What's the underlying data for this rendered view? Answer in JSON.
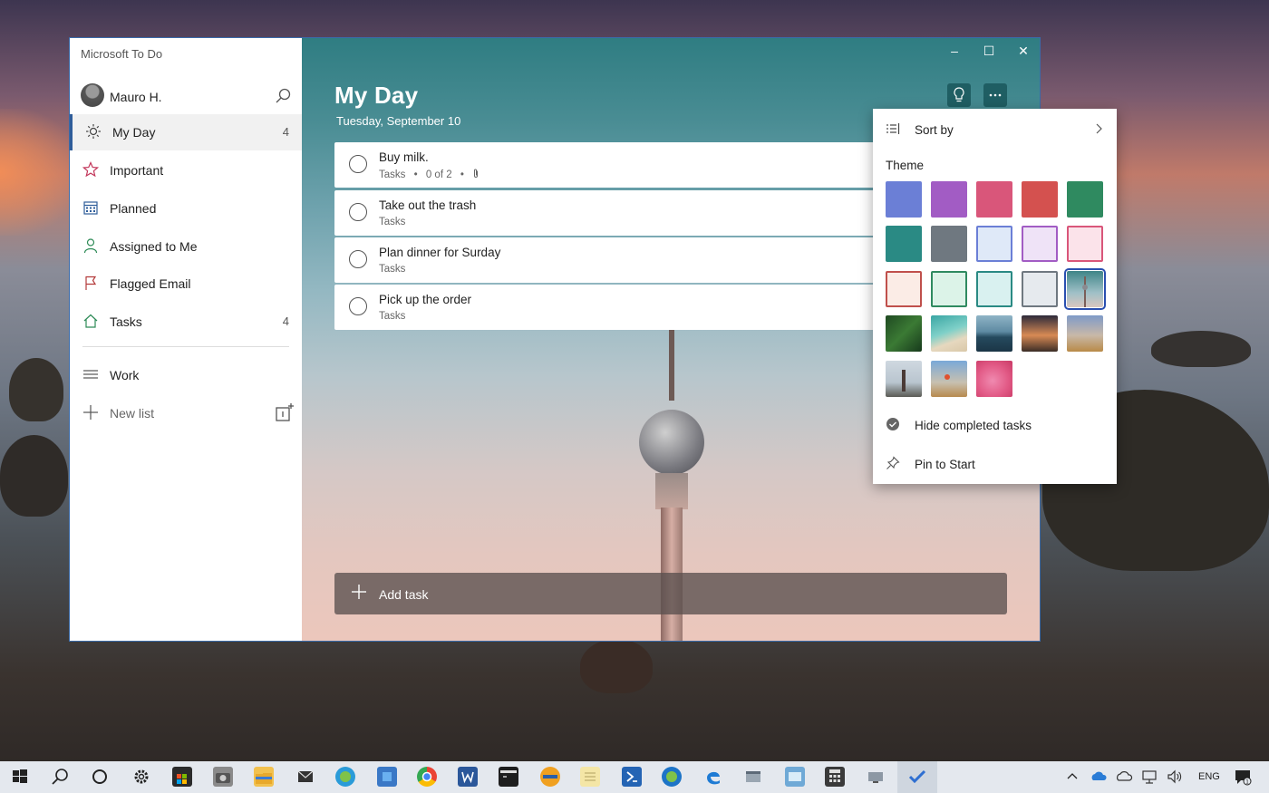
{
  "app": {
    "title": "Microsoft To Do",
    "window_controls": {
      "minimize": "–",
      "maximize": "☐",
      "close": "✕"
    }
  },
  "profile": {
    "name": "Mauro H."
  },
  "sidebar": {
    "items": [
      {
        "label": "My Day",
        "count": "4",
        "icon": "sun-icon",
        "color": "#444444"
      },
      {
        "label": "Important",
        "count": "",
        "icon": "star-icon",
        "color": "#c2365a"
      },
      {
        "label": "Planned",
        "count": "",
        "icon": "calendar-icon",
        "color": "#2f5d9a"
      },
      {
        "label": "Assigned to Me",
        "count": "",
        "icon": "person-icon",
        "color": "#2e8b57"
      },
      {
        "label": "Flagged Email",
        "count": "",
        "icon": "flag-icon",
        "color": "#b33b3b"
      },
      {
        "label": "Tasks",
        "count": "4",
        "icon": "home-icon",
        "color": "#2e8b57"
      }
    ],
    "lists": [
      {
        "label": "Work",
        "icon": "list-icon"
      }
    ],
    "new_list": "New list"
  },
  "main": {
    "title": "My Day",
    "date": "Tuesday, September 10",
    "tasks": [
      {
        "title": "Buy milk.",
        "meta_list": "Tasks",
        "meta_steps": "0 of 2",
        "has_attachment": true
      },
      {
        "title": "Take out the trash",
        "meta_list": "Tasks"
      },
      {
        "title": "Plan dinner for Surday",
        "meta_list": "Tasks"
      },
      {
        "title": "Pick up the order",
        "meta_list": "Tasks"
      }
    ],
    "meta_separator": "•",
    "add_task": "Add task"
  },
  "menu": {
    "sort_by": "Sort by",
    "theme": "Theme",
    "hide_completed": "Hide completed tasks",
    "pin_to_start": "Pin to Start",
    "selected_theme_index": 14,
    "theme_colors": [
      "#6b7fd6",
      "#a25cc4",
      "#d9567a",
      "#d4514f",
      "#2f8a60",
      "#2a8a84",
      "#6f7880",
      "#dfe9f8",
      "#efe3f7",
      "#fbe3ea",
      "#fbece6",
      "#dcf3e8",
      "#d9f1f0",
      "#e6eaee"
    ]
  },
  "taskbar": {
    "language": "ENG",
    "notification_count": "1"
  }
}
